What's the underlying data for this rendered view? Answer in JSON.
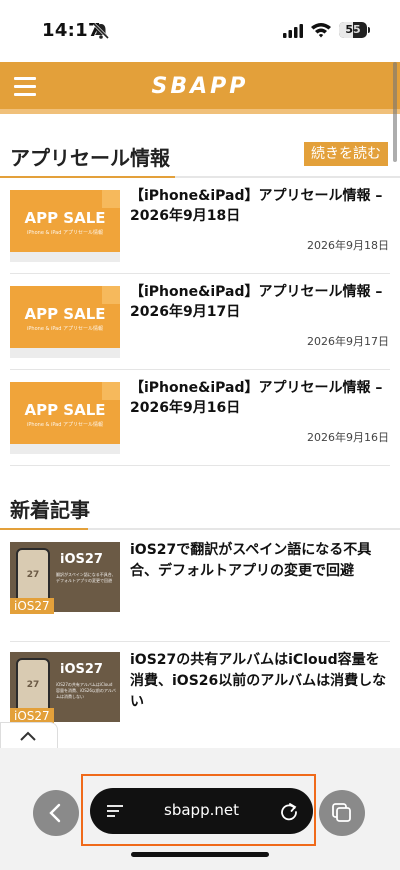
{
  "status": {
    "time": "14:17",
    "battery": "55"
  },
  "header": {
    "logo": "SBAPP"
  },
  "sale_section": {
    "title": "アプリセール情報",
    "more_label": "続きを読む",
    "thumb_big": "APP SALE",
    "thumb_small": "iPhone & iPad アプリセール情報",
    "items": [
      {
        "title": "【iPhone&iPad】アプリセール情報 – 2026年9月18日",
        "date": "2026年9月18日"
      },
      {
        "title": "【iPhone&iPad】アプリセール情報 – 2026年9月17日",
        "date": "2026年9月17日"
      },
      {
        "title": "【iPhone&iPad】アプリセール情報 – 2026年9月16日",
        "date": "2026年9月16日"
      }
    ]
  },
  "news_section": {
    "title": "新着記事",
    "items": [
      {
        "thumb_label": "iOS27",
        "thumb_sub": "翻訳がスペイン語になる不具合、デフォルトアプリの変更で回避",
        "tag": "iOS27",
        "title": "iOS27で翻訳がスペイン語になる不具合、デフォルトアプリの変更で回避"
      },
      {
        "thumb_label": "iOS27",
        "thumb_sub": "iOS27の共有アルバムはiCloud容量を消費、iOS26以前のアルバムは消費しない",
        "tag": "iOS27",
        "title": "iOS27の共有アルバムはiCloud容量を消費、iOS26以前のアルバムは消費しない"
      }
    ]
  },
  "toolbar": {
    "url": "sbapp.net"
  },
  "colors": {
    "accent": "#e3a03a",
    "highlight": "#f06a1a"
  }
}
